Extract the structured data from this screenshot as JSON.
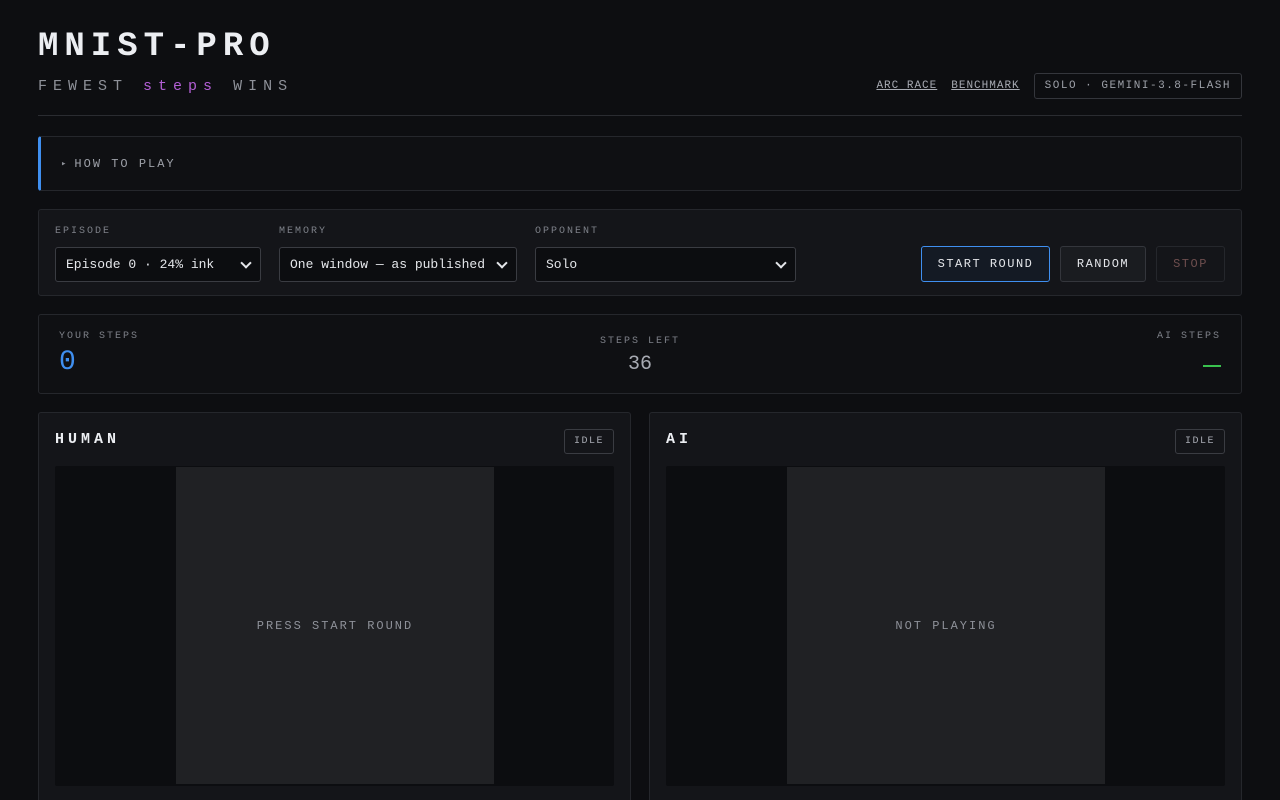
{
  "header": {
    "title": "MNIST-PRO",
    "subtitle_pre": "FEWEST",
    "subtitle_accent": "steps",
    "subtitle_post": "WINS",
    "links": [
      "ARC RACE",
      "BENCHMARK"
    ],
    "mode_badge": "SOLO · GEMINI-3.8-FLASH"
  },
  "howto": {
    "arrow": "▸",
    "label": "HOW TO PLAY"
  },
  "controls": {
    "episode": {
      "label": "EPISODE",
      "value": "Episode 0 · 24% ink"
    },
    "memory": {
      "label": "MEMORY",
      "value": "One window — as published"
    },
    "opponent": {
      "label": "OPPONENT",
      "value": "Solo"
    },
    "buttons": {
      "start": "START ROUND",
      "random": "RANDOM",
      "stop": "STOP"
    }
  },
  "score": {
    "your_steps_label": "YOUR STEPS",
    "your_steps_value": "0",
    "steps_left_label": "STEPS LEFT",
    "steps_left_value": "36",
    "ai_steps_label": "AI STEPS"
  },
  "panels": {
    "human": {
      "title": "HUMAN",
      "status": "IDLE",
      "message": "PRESS START ROUND"
    },
    "ai": {
      "title": "AI",
      "status": "IDLE",
      "message": "NOT PLAYING"
    }
  },
  "colors": {
    "accent_blue": "#3f8ff0",
    "accent_purple": "#b35fd6",
    "ai_green": "#39c24e"
  }
}
